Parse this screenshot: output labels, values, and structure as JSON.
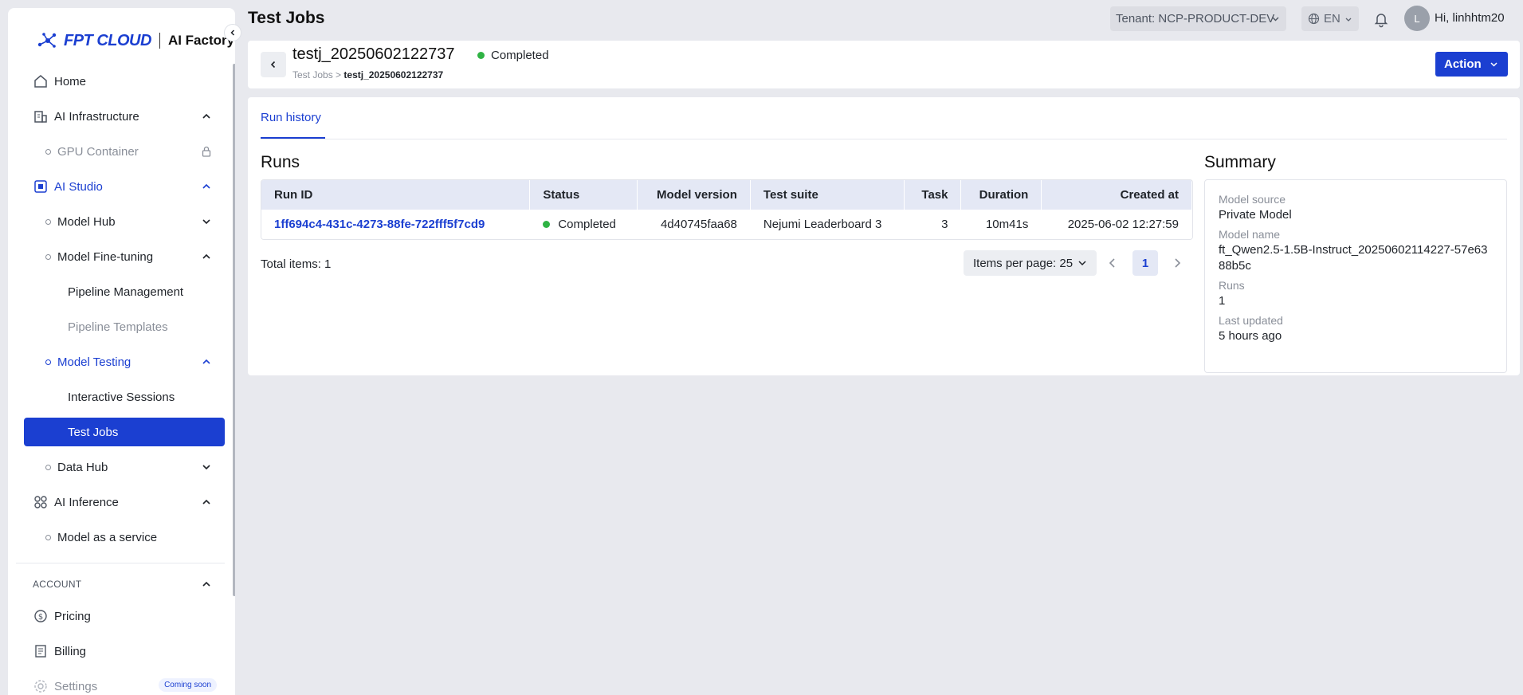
{
  "brand": {
    "logo_text": "FPT CLOUD",
    "product": "AI Factory"
  },
  "sidebar": {
    "items": [
      {
        "label": "Home"
      },
      {
        "label": "AI Infrastructure"
      },
      {
        "label": "GPU Container"
      },
      {
        "label": "AI Studio"
      },
      {
        "label": "Model Hub"
      },
      {
        "label": "Model Fine-tuning"
      },
      {
        "label": "Pipeline Management"
      },
      {
        "label": "Pipeline Templates"
      },
      {
        "label": "Model Testing"
      },
      {
        "label": "Interactive Sessions"
      },
      {
        "label": "Test Jobs"
      },
      {
        "label": "Data Hub"
      },
      {
        "label": "AI Inference"
      },
      {
        "label": "Model as a service"
      }
    ],
    "account_section": "ACCOUNT",
    "account_items": [
      {
        "label": "Pricing"
      },
      {
        "label": "Billing"
      },
      {
        "label": "Settings",
        "badge": "Coming soon"
      }
    ]
  },
  "header": {
    "page_title": "Test Jobs",
    "tenant": "Tenant: NCP-PRODUCT-DEV",
    "lang": "EN",
    "avatar_initial": "L",
    "greeting": "Hi, linhhtm20"
  },
  "job": {
    "title": "testj_20250602122737",
    "status": "Completed",
    "breadcrumb_parent": "Test Jobs",
    "breadcrumb_sep": ">",
    "breadcrumb_current": "testj_20250602122737",
    "action_label": "Action"
  },
  "tabs": [
    {
      "label": "Run history"
    }
  ],
  "runs": {
    "title": "Runs",
    "columns": [
      "Run ID",
      "Status",
      "Model version",
      "Test suite",
      "Task",
      "Duration",
      "Created at"
    ],
    "rows": [
      {
        "run_id": "1ff694c4-431c-4273-88fe-722fff5f7cd9",
        "status": "Completed",
        "model_version": "4d40745faa68",
        "test_suite": "Nejumi Leaderboard 3",
        "task": "3",
        "duration": "10m41s",
        "created_at": "2025-06-02 12:27:59"
      }
    ],
    "total_label": "Total items: 1",
    "per_page_label": "Items per page: 25",
    "current_page": "1"
  },
  "summary": {
    "title": "Summary",
    "model_source_label": "Model source",
    "model_source": "Private Model",
    "model_name_label": "Model name",
    "model_name": "ft_Qwen2.5-1.5B-Instruct_20250602114227-57e6388b5c",
    "runs_label": "Runs",
    "runs": "1",
    "last_updated_label": "Last updated",
    "last_updated": "5 hours ago"
  },
  "colors": {
    "accent": "#1b3fd1",
    "success": "#2fb344",
    "background": "#e8e9ee"
  }
}
